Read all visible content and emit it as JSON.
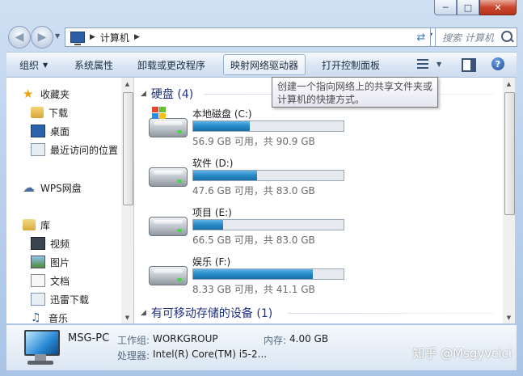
{
  "window": {
    "caption_buttons": [
      "minimize",
      "maximize",
      "close"
    ]
  },
  "navigation": {
    "address_path": "计算机",
    "search_placeholder": "搜索 计算机"
  },
  "toolbar": {
    "items": [
      "组织",
      "系统属性",
      "卸载或更改程序",
      "映射网络驱动器",
      "打开控制面板"
    ],
    "organize_has_dropdown": true,
    "active_item": "映射网络驱动器"
  },
  "tooltip": {
    "text": "创建一个指向网络上的共享文件夹或计算机的快捷方式。"
  },
  "sidebar": {
    "favorites": {
      "label": "收藏夹",
      "items": [
        "下载",
        "桌面",
        "最近访问的位置"
      ]
    },
    "wps": "WPS网盘",
    "libraries": {
      "label": "库",
      "items": [
        "视频",
        "图片",
        "文档",
        "迅雷下载",
        "音乐"
      ]
    }
  },
  "main": {
    "hard_disks_header": "硬盘 (4)",
    "drives": [
      {
        "name": "本地磁盘 (C:)",
        "free": "56.9 GB 可用，共 90.9 GB",
        "used_fraction": 0.374,
        "system": true
      },
      {
        "name": "软件 (D:)",
        "free": "47.6 GB 可用，共 83.0 GB",
        "used_fraction": 0.427,
        "system": false
      },
      {
        "name": "项目 (E:)",
        "free": "66.5 GB 可用，共 83.0 GB",
        "used_fraction": 0.199,
        "system": false
      },
      {
        "name": "娱乐 (F:)",
        "free": "8.33 GB 可用，共 41.1 GB",
        "used_fraction": 0.797,
        "system": false
      }
    ],
    "removable_header": "有可移动存储的设备 (1)"
  },
  "details": {
    "computer_name": "MSG-PC",
    "workgroup_label": "工作组:",
    "workgroup_value": "WORKGROUP",
    "memory_label": "内存:",
    "memory_value": "4.00 GB",
    "processor_label": "处理器:",
    "processor_value": "Intel(R) Core(TM) i5-2..."
  },
  "watermark": "知乎 @Msgyvcici",
  "colors": {
    "group_header": "#1e3287",
    "bar_fill": "#268ac8",
    "close_button": "#c9462d"
  }
}
